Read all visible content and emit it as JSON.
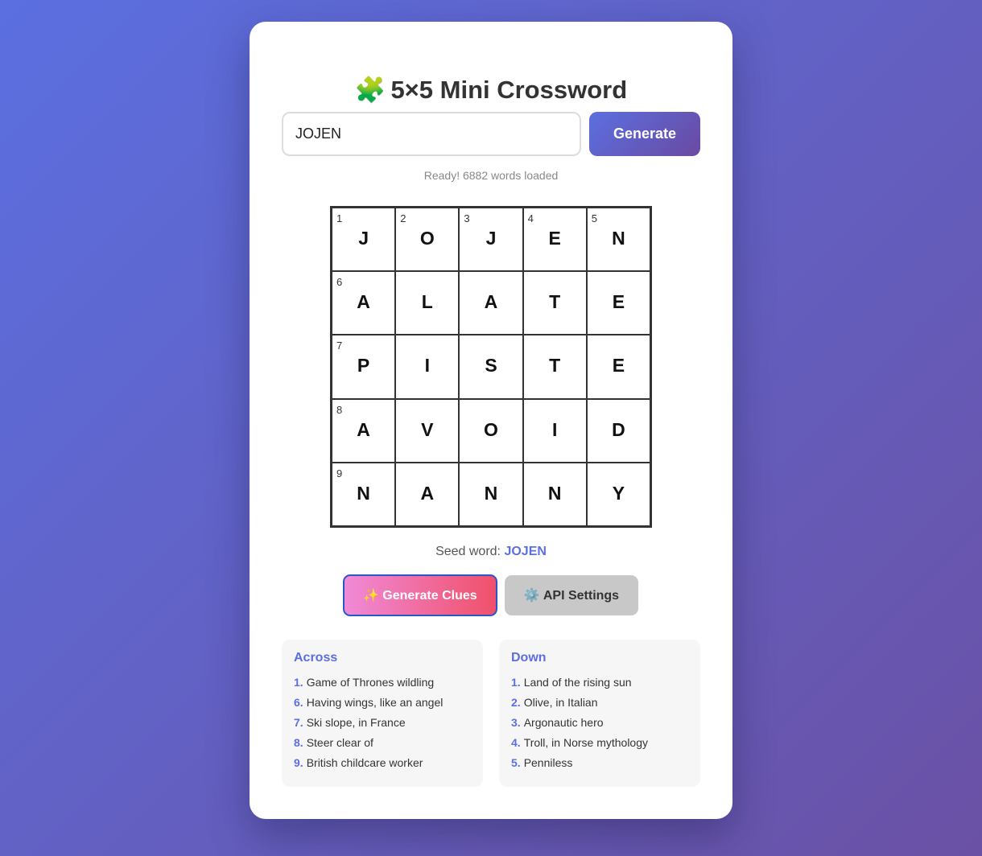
{
  "title": {
    "icon": "puzzle-piece-icon",
    "icon_glyph": "🧩",
    "text": "5×5 Mini Crossword"
  },
  "seed_input": {
    "value": "JOJEN",
    "placeholder": ""
  },
  "generate_button": {
    "label": "Generate"
  },
  "status": "Ready! 6882 words loaded",
  "grid": {
    "rows": [
      [
        {
          "num": "1",
          "letter": "J"
        },
        {
          "num": "2",
          "letter": "O"
        },
        {
          "num": "3",
          "letter": "J"
        },
        {
          "num": "4",
          "letter": "E"
        },
        {
          "num": "5",
          "letter": "N"
        }
      ],
      [
        {
          "num": "6",
          "letter": "A"
        },
        {
          "num": "",
          "letter": "L"
        },
        {
          "num": "",
          "letter": "A"
        },
        {
          "num": "",
          "letter": "T"
        },
        {
          "num": "",
          "letter": "E"
        }
      ],
      [
        {
          "num": "7",
          "letter": "P"
        },
        {
          "num": "",
          "letter": "I"
        },
        {
          "num": "",
          "letter": "S"
        },
        {
          "num": "",
          "letter": "T"
        },
        {
          "num": "",
          "letter": "E"
        }
      ],
      [
        {
          "num": "8",
          "letter": "A"
        },
        {
          "num": "",
          "letter": "V"
        },
        {
          "num": "",
          "letter": "O"
        },
        {
          "num": "",
          "letter": "I"
        },
        {
          "num": "",
          "letter": "D"
        }
      ],
      [
        {
          "num": "9",
          "letter": "N"
        },
        {
          "num": "",
          "letter": "A"
        },
        {
          "num": "",
          "letter": "N"
        },
        {
          "num": "",
          "letter": "N"
        },
        {
          "num": "",
          "letter": "Y"
        }
      ]
    ]
  },
  "seed_line": {
    "label": "Seed word:",
    "value": "JOJEN"
  },
  "clues_button": {
    "icon": "sparkles-icon",
    "icon_glyph": "✨",
    "label": "Generate Clues"
  },
  "api_button": {
    "icon": "gear-icon",
    "icon_glyph": "⚙️",
    "label": "API Settings"
  },
  "across": {
    "heading": "Across",
    "clues": [
      {
        "num": "1.",
        "text": "Game of Thrones wildling"
      },
      {
        "num": "6.",
        "text": "Having wings, like an angel"
      },
      {
        "num": "7.",
        "text": "Ski slope, in France"
      },
      {
        "num": "8.",
        "text": "Steer clear of"
      },
      {
        "num": "9.",
        "text": "British childcare worker"
      }
    ]
  },
  "down": {
    "heading": "Down",
    "clues": [
      {
        "num": "1.",
        "text": "Land of the rising sun"
      },
      {
        "num": "2.",
        "text": "Olive, in Italian"
      },
      {
        "num": "3.",
        "text": "Argonautic hero"
      },
      {
        "num": "4.",
        "text": "Troll, in Norse mythology"
      },
      {
        "num": "5.",
        "text": "Penniless"
      }
    ]
  },
  "colors": {
    "accent": "#5b6fe0",
    "background_start": "#5b6fe0",
    "background_end": "#6a51a5",
    "clue_button_start": "#f08ad8",
    "clue_button_end": "#f0506a",
    "api_button": "#c8c8c8"
  }
}
